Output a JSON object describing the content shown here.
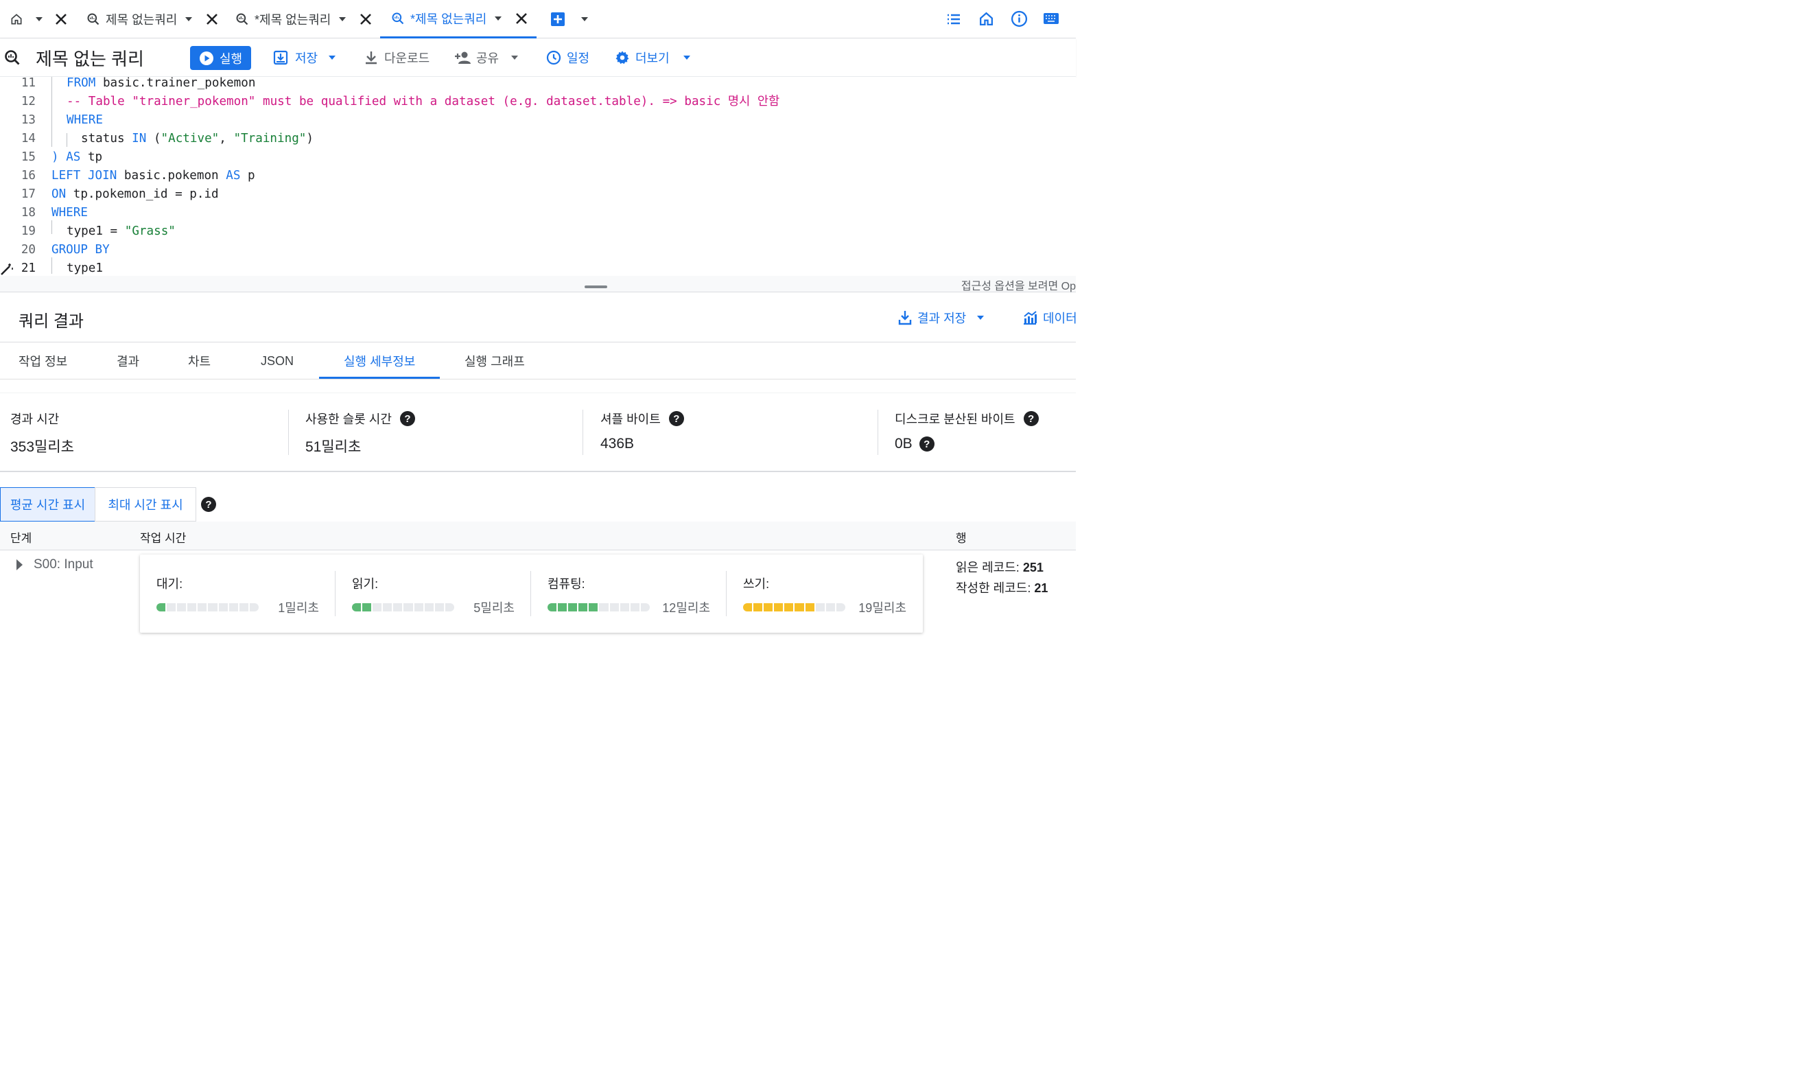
{
  "tabs": [
    {
      "label": "제목 없는쿼리",
      "active": false
    },
    {
      "label": "*제목 없는쿼리",
      "active": false
    },
    {
      "label": "*제목 없는쿼리",
      "active": true
    }
  ],
  "toolbar": {
    "title": "제목 없는 쿼리",
    "run_label": "실행",
    "save_label": "저장",
    "download_label": "다운로드",
    "share_label": "공유",
    "schedule_label": "일정",
    "more_label": "더보기"
  },
  "editor": {
    "lines": [
      {
        "num": "11"
      },
      {
        "num": "12"
      },
      {
        "num": "13"
      },
      {
        "num": "14"
      },
      {
        "num": "15"
      },
      {
        "num": "16"
      },
      {
        "num": "17"
      },
      {
        "num": "18"
      },
      {
        "num": "19"
      },
      {
        "num": "20"
      },
      {
        "num": "21"
      }
    ],
    "code": {
      "l11_kw": "FROM",
      "l11_rest": " basic.trainer_pokemon",
      "l12": "-- Table \"trainer_pokemon\" must be qualified with a dataset (e.g. dataset.table). => basic 명시 안함",
      "l13_kw": "WHERE",
      "l14_a": "status ",
      "l14_kw": "IN",
      "l14_b": " (",
      "l14_s1": "\"Active\"",
      "l14_c": ", ",
      "l14_s2": "\"Training\"",
      "l14_d": ")",
      "l15_a": ") ",
      "l15_kw": "AS",
      "l15_b": " tp",
      "l16_kw1": "LEFT JOIN",
      "l16_a": " basic.pokemon ",
      "l16_kw2": "AS",
      "l16_b": " p",
      "l17_kw": "ON",
      "l17_a": " tp.pokemon_id = p.id",
      "l18_kw": "WHERE",
      "l19_a": "type1 = ",
      "l19_s": "\"Grass\"",
      "l20_kw": "GROUP BY",
      "l21_a": "type1"
    },
    "a11y_hint": "접근성 옵션을 보려면 Op"
  },
  "results": {
    "title": "쿼리 결과",
    "save_results_label": "결과 저장",
    "explore_label": "데이터",
    "tabs": [
      "작업 정보",
      "결과",
      "차트",
      "JSON",
      "실행 세부정보",
      "실행 그래프"
    ],
    "active_tab": "실행 세부정보",
    "metrics": [
      {
        "label": "경과 시간",
        "value": "353밀리초"
      },
      {
        "label": "사용한 슬롯 시간",
        "value": "51밀리초"
      },
      {
        "label": "셔플 바이트",
        "value": "436B"
      },
      {
        "label": "디스크로 분산된 바이트",
        "value": "0B"
      }
    ],
    "toggle_avg": "평균 시간 표시",
    "toggle_max": "최대 시간 표시",
    "columns": {
      "stage": "단계",
      "work_time": "작업 시간",
      "rows": "행"
    },
    "stage": {
      "name": "S00: Input",
      "segments": [
        {
          "label": "대기:",
          "value": "1밀리초",
          "fill": 0.05,
          "color": "#5bb974"
        },
        {
          "label": "읽기:",
          "value": "5밀리초",
          "fill": 0.2,
          "color": "#5bb974"
        },
        {
          "label": "컴퓨팅:",
          "value": "12밀리초",
          "fill": 0.45,
          "color": "#5bb974"
        },
        {
          "label": "쓰기:",
          "value": "19밀리초",
          "fill": 0.65,
          "color": "#f6bf26"
        }
      ],
      "records_read_label": "읽은 레코드:",
      "records_read": "251",
      "records_written_label": "작성한 레코드:",
      "records_written": "21"
    }
  },
  "colors": {
    "accent": "#1a73e8",
    "comment": "#d01884",
    "string": "#188038"
  }
}
